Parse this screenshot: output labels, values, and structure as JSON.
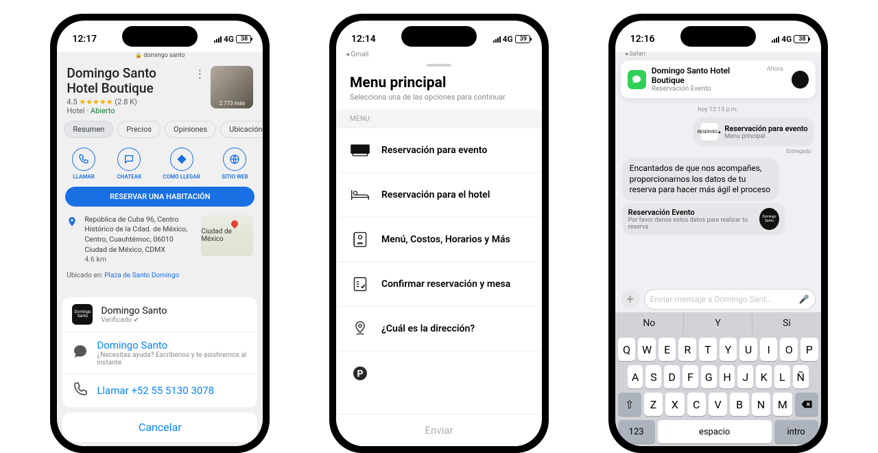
{
  "phone1": {
    "time": "12:17",
    "signal": "4G",
    "battery_pct": 38,
    "search": "domingo santo",
    "title": "Domingo Santo Hotel Boutique",
    "rating": "4.5",
    "stars": "★★★★★",
    "reviews": "(2.8 K)",
    "category": "Hotel",
    "open": "Abierto",
    "thumb_more": "2.773 más",
    "tabs": [
      "Resumen",
      "Precios",
      "Opiniones",
      "Ubicación"
    ],
    "actions": {
      "call": "LLAMAR",
      "chat": "CHATEAR",
      "dir": "COMO LLEGAR",
      "web": "SITIO WEB"
    },
    "book_btn": "RESERVAR UNA HABITACIÓN",
    "address": "República de Cuba 96, Centro Histórico de la Cdad. de México, Centro, Cuauhtémoc, 06010 Ciudad de México, CDMX",
    "distance": "4.6 km",
    "map_label": "Ciudad de México",
    "located_label": "Ubicado en:",
    "located_link": "Plaza de Santo Domingo",
    "sheet": {
      "biz": "Domingo Santo",
      "verified": "Verificado",
      "chat_name": "Domingo Santo",
      "chat_help": "¿Necesitas ayuda? Escríbenos y te asistiremos al instante",
      "call": "Llamar +52 55  5130 3078",
      "cancel": "Cancelar"
    }
  },
  "phone2": {
    "time": "12:14",
    "signal": "4G",
    "battery_pct": 39,
    "back": "Gmail",
    "title": "Menu principal",
    "subtitle": "Selecciona una de las opciones para continuar",
    "section": "MENU",
    "items": [
      "Reservación para evento",
      "Reservación para el hotel",
      "Menú, Costos, Horarios y Más",
      "Confirmar reservación y mesa",
      "¿Cuál es la dirección?"
    ],
    "send": "Enviar"
  },
  "phone3": {
    "time": "12:16",
    "signal": "4G",
    "battery_pct": 38,
    "back": "Safari",
    "banner_title": "Domingo Santo Hotel Boutique",
    "banner_sub": "Reservación Evento",
    "banner_now": "Ahora",
    "timestamp": "hoy 12:15 p.m.",
    "card1_title": "Reservación para evento",
    "card1_sub": "Menu principal",
    "delivered": "Entregado",
    "reply": "Encantados de que nos acompañes, proporcionarnos los datos de tu reserva para hacer más ágil el proceso",
    "card2_title": "Reservación Evento",
    "card2_sub": "Por favor danos estos datos para realizar tu reserva",
    "placeholder": "Enviar mensaje a Domingo Sant…",
    "quicktype": [
      "No",
      "Y",
      "Si"
    ],
    "kb_rows": [
      [
        "Q",
        "W",
        "E",
        "R",
        "T",
        "Y",
        "U",
        "I",
        "O",
        "P"
      ],
      [
        "A",
        "S",
        "D",
        "F",
        "G",
        "H",
        "J",
        "K",
        "L",
        "Ñ"
      ],
      [
        "Z",
        "X",
        "C",
        "V",
        "B",
        "N",
        "M"
      ]
    ],
    "kb_123": "123",
    "kb_space": "espacio",
    "kb_enter": "intro"
  }
}
